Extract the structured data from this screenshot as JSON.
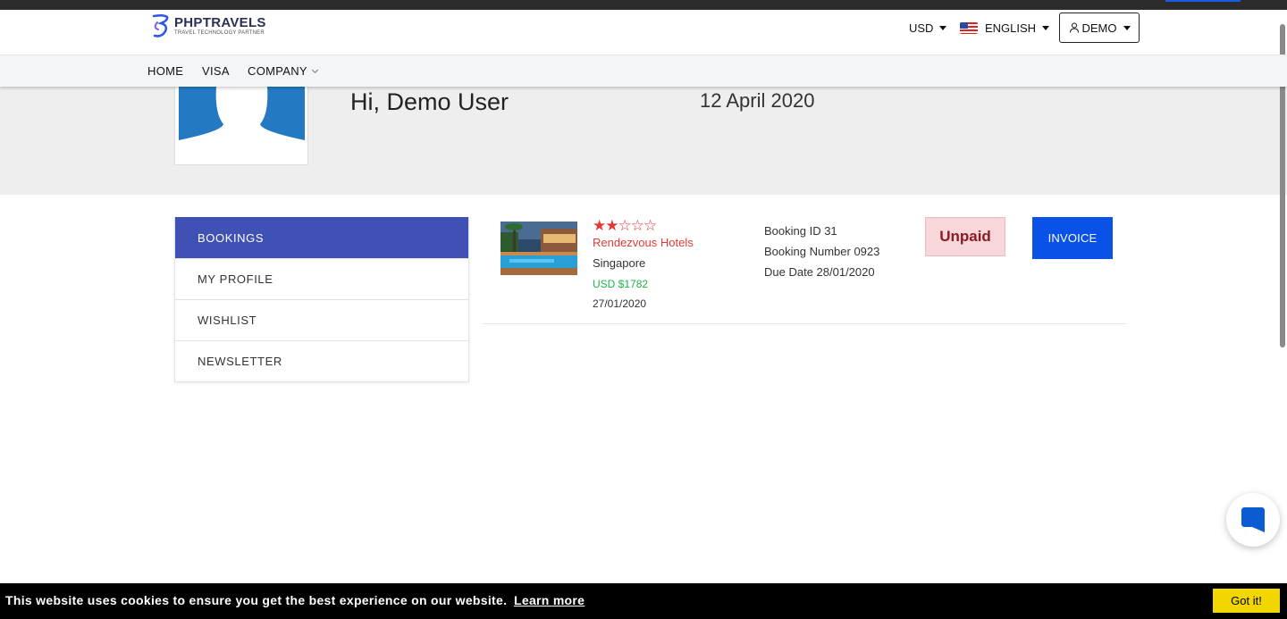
{
  "header": {
    "logo_name": "PHPTRAVELS",
    "logo_tagline": "TRAVEL TECHNOLOGY PARTNER",
    "currency": "USD",
    "language": "ENGLISH",
    "account": "DEMO"
  },
  "nav": {
    "home": "HOME",
    "visa": "VISA",
    "company": "COMPANY"
  },
  "profile": {
    "greeting": "Hi, Demo User",
    "date": "12 April 2020"
  },
  "menu": {
    "items": [
      {
        "label": "BOOKINGS"
      },
      {
        "label": "MY PROFILE"
      },
      {
        "label": "WISHLIST"
      },
      {
        "label": "NEWSLETTER"
      }
    ]
  },
  "booking": {
    "rating": 2,
    "rating_max": 5,
    "hotel_name": "Rendezvous Hotels",
    "city": "Singapore",
    "price": "USD $1782",
    "date": "27/01/2020",
    "booking_id": "Booking ID 31",
    "booking_number": "Booking Number 0923",
    "due_date": "Due Date 28/01/2020",
    "status": "Unpaid",
    "invoice_label": "INVOICE"
  },
  "cookie": {
    "message": "This website uses cookies to ensure you get the best experience on our website.",
    "learn_more": "Learn more",
    "accept": "Got it!"
  },
  "colors": {
    "menu_active": "#3f51b5",
    "invoice_button": "#0a51e8",
    "status_unpaid_bg": "#f8d7da",
    "hotel_name": "#e53935",
    "price": "#22b34a",
    "cookie_button": "#f1d600"
  },
  "icons": {
    "avatar": "user-silhouette-icon",
    "chat": "chat-bubble-icon",
    "account": "user-outline-icon",
    "flag": "us-flag-icon"
  }
}
